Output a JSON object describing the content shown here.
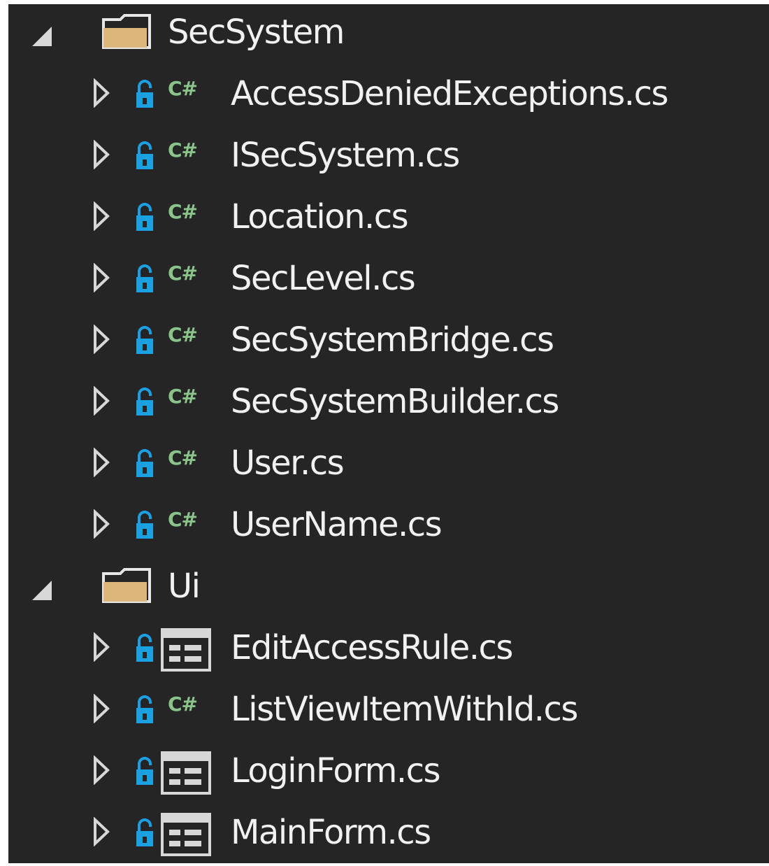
{
  "tree": {
    "folders": [
      {
        "name": "SecSystem",
        "files": [
          {
            "name": "AccessDeniedExceptions.cs",
            "badge": "C#"
          },
          {
            "name": "ISecSystem.cs",
            "badge": "C#"
          },
          {
            "name": "Location.cs",
            "badge": "C#"
          },
          {
            "name": "SecLevel.cs",
            "badge": "C#"
          },
          {
            "name": "SecSystemBridge.cs",
            "badge": "C#"
          },
          {
            "name": "SecSystemBuilder.cs",
            "badge": "C#"
          },
          {
            "name": "User.cs",
            "badge": "C#"
          },
          {
            "name": "UserName.cs",
            "badge": "C#"
          }
        ]
      },
      {
        "name": "Ui",
        "files": [
          {
            "name": "EditAccessRule.cs"
          },
          {
            "name": "ListViewItemWithId.cs",
            "badge": "C#"
          },
          {
            "name": "LoginForm.cs"
          },
          {
            "name": "MainForm.cs"
          }
        ]
      }
    ]
  },
  "colors": {
    "background": "#252526",
    "text": "#f1f1f1",
    "csharp_badge": "#8bc48a",
    "lock": "#1ba1e2",
    "folder": "#dcb67a"
  },
  "icons": {
    "folder": "folder-icon",
    "lock": "lock-icon",
    "csharp": "csharp-icon",
    "form": "form-icon",
    "expanded": "expanded-chevron-icon",
    "collapsed": "collapsed-chevron-icon"
  }
}
